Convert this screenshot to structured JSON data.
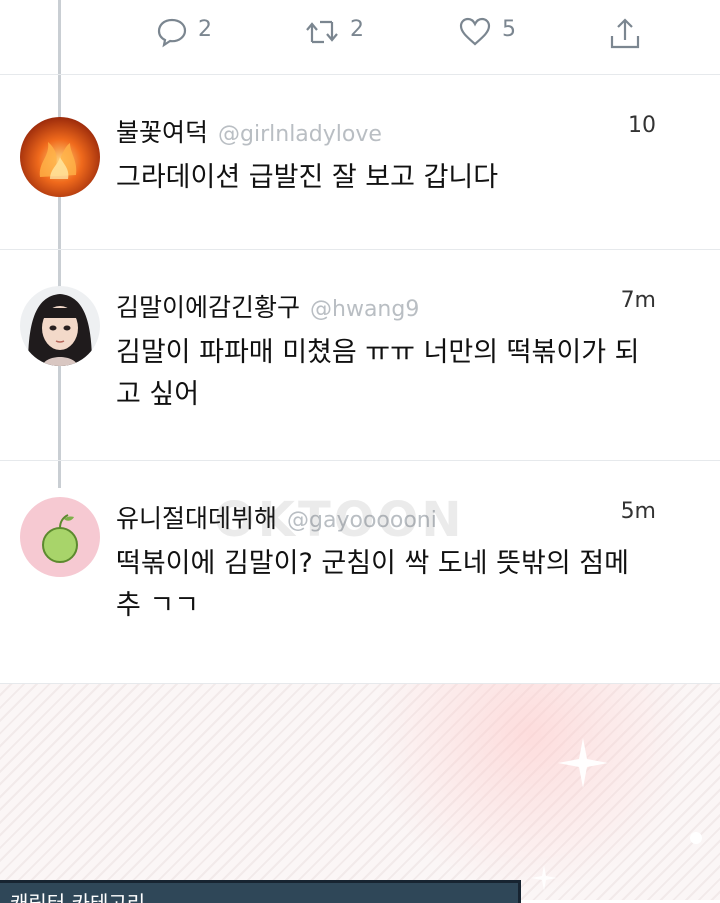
{
  "actions": {
    "reply": {
      "icon": "reply-icon",
      "count": "2"
    },
    "retweet": {
      "icon": "retweet-icon",
      "count": "2"
    },
    "like": {
      "icon": "heart-icon",
      "count": "5"
    },
    "share": {
      "icon": "share-icon"
    }
  },
  "comments": [
    {
      "name": "불꽃여덕",
      "handle": "@girlnladylove",
      "time": "10",
      "text": "그라데이션 급발진 잘 보고 갑니다",
      "avatar": "fire-avatar"
    },
    {
      "name": "김말이에감긴황구",
      "handle": "@hwang9",
      "time": "7m",
      "text": "김말이 파파매 미쳤음 ㅠㅠ 너만의 떡볶이가 되고 싶어",
      "avatar": "girl-avatar"
    },
    {
      "name": "유니절대데뷔해",
      "handle": "@gayoooooni",
      "time": "5m",
      "text": "떡볶이에 김말이? 군침이 싹 도네 뜻밖의 점메추 ㄱㄱ",
      "avatar": "melon-avatar"
    }
  ],
  "watermark": "OKTOON",
  "bottom_caption": "캐릭터 카테고리",
  "colors": {
    "meta": "#7b8690",
    "handle": "#b9bec3",
    "divider": "#e6e9ec",
    "avatar3_bg": "#f6c9d2",
    "bottom_box": "#2f4758"
  }
}
